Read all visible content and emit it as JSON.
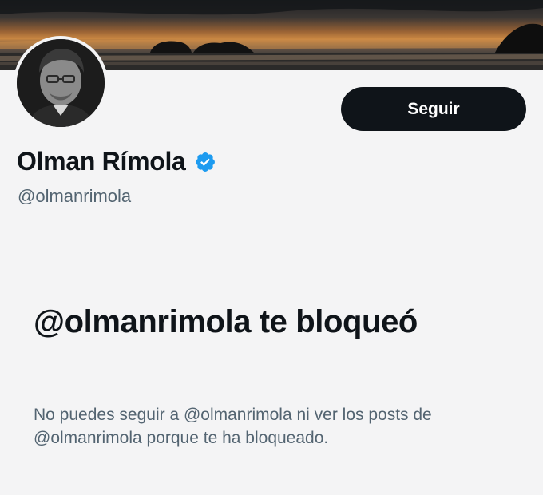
{
  "profile": {
    "display_name": "Olman Rímola",
    "handle": "@olmanrimola",
    "verified": true,
    "avatar_icon": "person-portrait",
    "banner_image": "sunset-sea-islands"
  },
  "actions": {
    "follow_label": "Seguir"
  },
  "blocked_notice": {
    "title": "@olmanrimola te bloqueó",
    "description": "No puedes seguir a @olmanrimola ni ver los posts de @olmanrimola porque te ha bloqueado."
  },
  "colors": {
    "background": "#f4f4f5",
    "button_bg": "#0f1419",
    "button_text": "#ffffff",
    "verified_blue": "#1d9bf0",
    "secondary_text": "#536471",
    "primary_text": "#0f1419"
  }
}
